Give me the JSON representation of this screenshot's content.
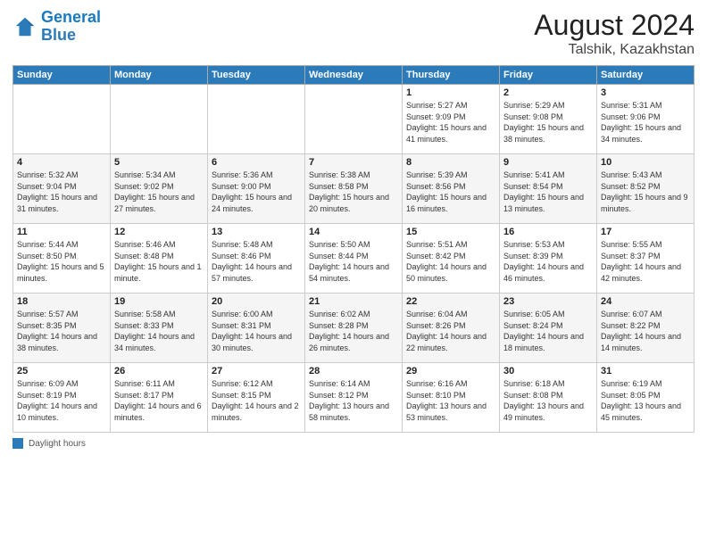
{
  "header": {
    "logo_general": "General",
    "logo_blue": "Blue",
    "month_title": "August 2024",
    "location": "Talshik, Kazakhstan"
  },
  "weekdays": [
    "Sunday",
    "Monday",
    "Tuesday",
    "Wednesday",
    "Thursday",
    "Friday",
    "Saturday"
  ],
  "footer": {
    "label": "Daylight hours"
  },
  "weeks": [
    [
      {
        "day": "",
        "info": ""
      },
      {
        "day": "",
        "info": ""
      },
      {
        "day": "",
        "info": ""
      },
      {
        "day": "",
        "info": ""
      },
      {
        "day": "1",
        "info": "Sunrise: 5:27 AM\nSunset: 9:09 PM\nDaylight: 15 hours\nand 41 minutes."
      },
      {
        "day": "2",
        "info": "Sunrise: 5:29 AM\nSunset: 9:08 PM\nDaylight: 15 hours\nand 38 minutes."
      },
      {
        "day": "3",
        "info": "Sunrise: 5:31 AM\nSunset: 9:06 PM\nDaylight: 15 hours\nand 34 minutes."
      }
    ],
    [
      {
        "day": "4",
        "info": "Sunrise: 5:32 AM\nSunset: 9:04 PM\nDaylight: 15 hours\nand 31 minutes."
      },
      {
        "day": "5",
        "info": "Sunrise: 5:34 AM\nSunset: 9:02 PM\nDaylight: 15 hours\nand 27 minutes."
      },
      {
        "day": "6",
        "info": "Sunrise: 5:36 AM\nSunset: 9:00 PM\nDaylight: 15 hours\nand 24 minutes."
      },
      {
        "day": "7",
        "info": "Sunrise: 5:38 AM\nSunset: 8:58 PM\nDaylight: 15 hours\nand 20 minutes."
      },
      {
        "day": "8",
        "info": "Sunrise: 5:39 AM\nSunset: 8:56 PM\nDaylight: 15 hours\nand 16 minutes."
      },
      {
        "day": "9",
        "info": "Sunrise: 5:41 AM\nSunset: 8:54 PM\nDaylight: 15 hours\nand 13 minutes."
      },
      {
        "day": "10",
        "info": "Sunrise: 5:43 AM\nSunset: 8:52 PM\nDaylight: 15 hours\nand 9 minutes."
      }
    ],
    [
      {
        "day": "11",
        "info": "Sunrise: 5:44 AM\nSunset: 8:50 PM\nDaylight: 15 hours\nand 5 minutes."
      },
      {
        "day": "12",
        "info": "Sunrise: 5:46 AM\nSunset: 8:48 PM\nDaylight: 15 hours\nand 1 minute."
      },
      {
        "day": "13",
        "info": "Sunrise: 5:48 AM\nSunset: 8:46 PM\nDaylight: 14 hours\nand 57 minutes."
      },
      {
        "day": "14",
        "info": "Sunrise: 5:50 AM\nSunset: 8:44 PM\nDaylight: 14 hours\nand 54 minutes."
      },
      {
        "day": "15",
        "info": "Sunrise: 5:51 AM\nSunset: 8:42 PM\nDaylight: 14 hours\nand 50 minutes."
      },
      {
        "day": "16",
        "info": "Sunrise: 5:53 AM\nSunset: 8:39 PM\nDaylight: 14 hours\nand 46 minutes."
      },
      {
        "day": "17",
        "info": "Sunrise: 5:55 AM\nSunset: 8:37 PM\nDaylight: 14 hours\nand 42 minutes."
      }
    ],
    [
      {
        "day": "18",
        "info": "Sunrise: 5:57 AM\nSunset: 8:35 PM\nDaylight: 14 hours\nand 38 minutes."
      },
      {
        "day": "19",
        "info": "Sunrise: 5:58 AM\nSunset: 8:33 PM\nDaylight: 14 hours\nand 34 minutes."
      },
      {
        "day": "20",
        "info": "Sunrise: 6:00 AM\nSunset: 8:31 PM\nDaylight: 14 hours\nand 30 minutes."
      },
      {
        "day": "21",
        "info": "Sunrise: 6:02 AM\nSunset: 8:28 PM\nDaylight: 14 hours\nand 26 minutes."
      },
      {
        "day": "22",
        "info": "Sunrise: 6:04 AM\nSunset: 8:26 PM\nDaylight: 14 hours\nand 22 minutes."
      },
      {
        "day": "23",
        "info": "Sunrise: 6:05 AM\nSunset: 8:24 PM\nDaylight: 14 hours\nand 18 minutes."
      },
      {
        "day": "24",
        "info": "Sunrise: 6:07 AM\nSunset: 8:22 PM\nDaylight: 14 hours\nand 14 minutes."
      }
    ],
    [
      {
        "day": "25",
        "info": "Sunrise: 6:09 AM\nSunset: 8:19 PM\nDaylight: 14 hours\nand 10 minutes."
      },
      {
        "day": "26",
        "info": "Sunrise: 6:11 AM\nSunset: 8:17 PM\nDaylight: 14 hours\nand 6 minutes."
      },
      {
        "day": "27",
        "info": "Sunrise: 6:12 AM\nSunset: 8:15 PM\nDaylight: 14 hours\nand 2 minutes."
      },
      {
        "day": "28",
        "info": "Sunrise: 6:14 AM\nSunset: 8:12 PM\nDaylight: 13 hours\nand 58 minutes."
      },
      {
        "day": "29",
        "info": "Sunrise: 6:16 AM\nSunset: 8:10 PM\nDaylight: 13 hours\nand 53 minutes."
      },
      {
        "day": "30",
        "info": "Sunrise: 6:18 AM\nSunset: 8:08 PM\nDaylight: 13 hours\nand 49 minutes."
      },
      {
        "day": "31",
        "info": "Sunrise: 6:19 AM\nSunset: 8:05 PM\nDaylight: 13 hours\nand 45 minutes."
      }
    ]
  ]
}
